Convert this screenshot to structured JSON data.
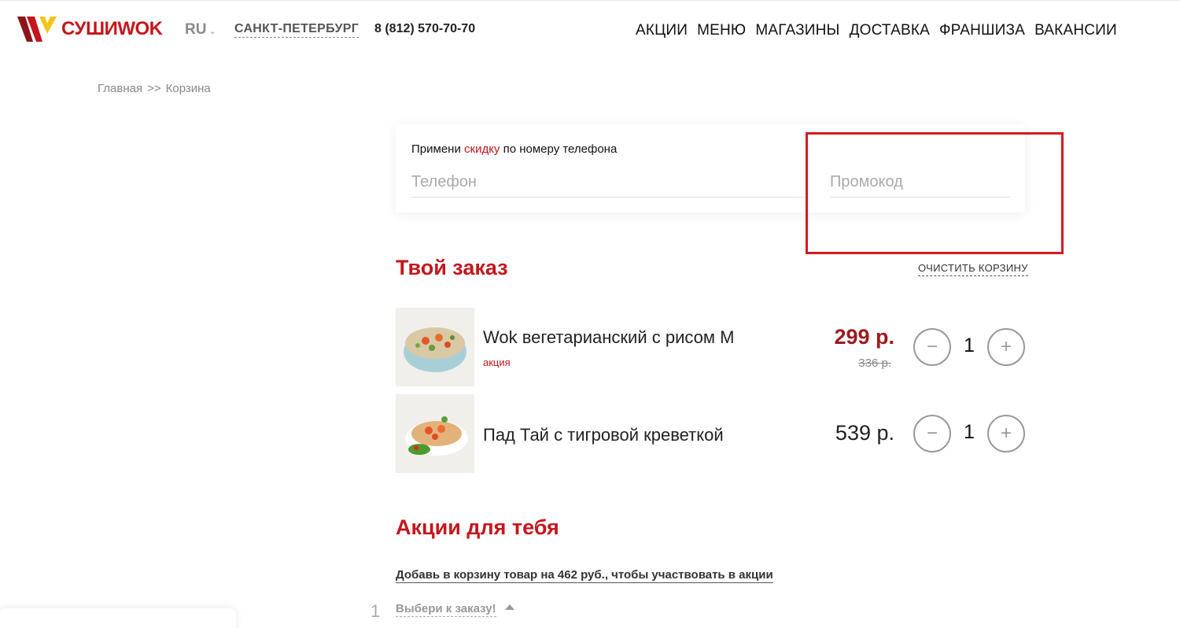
{
  "header": {
    "logo_text": "СУШИWOK",
    "lang": "RU",
    "city": "САНКТ-ПЕТЕРБУРГ",
    "phone": "8 (812) 570-70-70",
    "nav": [
      "АКЦИИ",
      "МЕНЮ",
      "МАГАЗИНЫ",
      "ДОСТАВКА",
      "ФРАНШИЗА",
      "ВАКАНСИИ"
    ],
    "brand_color": "#c4161c",
    "logo_accent_color": "#f5c518"
  },
  "breadcrumb": {
    "home": "Главная",
    "separator": ">>",
    "current": "Корзина"
  },
  "discount": {
    "note_prefix": "Примени ",
    "note_accent": "скидку",
    "note_suffix": " по номеру телефона",
    "phone_placeholder": "Телефон",
    "promo_placeholder": "Промокод",
    "highlight_color": "#d71920"
  },
  "order": {
    "title": "Твой заказ",
    "clear_label": "ОЧИСТИТЬ КОРЗИНУ",
    "items": [
      {
        "name": "Wok вегетарианский с рисом М",
        "tag": "акция",
        "price": "299 р.",
        "old_price": "336 р.",
        "quantity": "1",
        "image": "wok-bowl-image"
      },
      {
        "name": "Пад Тай с тигровой креветкой",
        "price": "539 р.",
        "quantity": "1",
        "image": "pad-thai-plate-image"
      }
    ],
    "minus_symbol": "−",
    "plus_symbol": "+"
  },
  "promotions": {
    "title": "Акции для тебя",
    "note": "Добавь в корзину товар на 462 руб., чтобы участвовать в акции",
    "index": "1",
    "select_label": "Выбери к заказу!"
  }
}
